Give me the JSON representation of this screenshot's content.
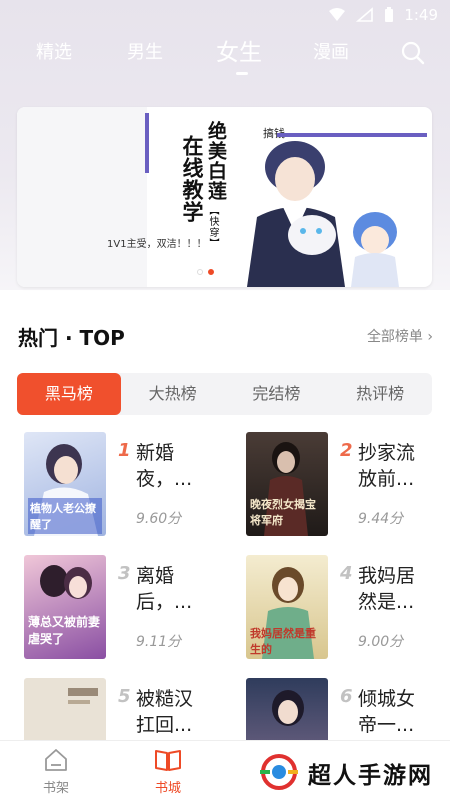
{
  "status_bar": {
    "time": "1:49"
  },
  "top_nav": {
    "tabs": [
      {
        "label": "精选",
        "active": false
      },
      {
        "label": "男生",
        "active": false
      },
      {
        "label": "女生",
        "active": true
      },
      {
        "label": "漫画",
        "active": false
      }
    ]
  },
  "banner": {
    "title_col1": "在线教学",
    "title_col2": "绝美白莲",
    "subtag": "【快穿】",
    "tag": "搞钱",
    "caption": "1V1主受，双洁！！！",
    "active_dot": 1,
    "dot_count": 2
  },
  "section": {
    "title": "热门 · TOP",
    "all_rank": "全部榜单 ›"
  },
  "rank_tabs": [
    {
      "label": "黑马榜",
      "active": true
    },
    {
      "label": "大热榜",
      "active": false
    },
    {
      "label": "完结榜",
      "active": false
    },
    {
      "label": "热评榜",
      "active": false
    }
  ],
  "books": [
    {
      "rank": "1",
      "title": "新婚夜，...",
      "score": "9.60分",
      "cover_text": "植物人老公撩醒了",
      "cover_color": "#b9c8ea"
    },
    {
      "rank": "2",
      "title": "抄家流放前...",
      "score": "9.44分",
      "cover_text": "晚夜烈女揭宝将军府",
      "cover_color": "#3b2f2c"
    },
    {
      "rank": "3",
      "title": "离婚后，...",
      "score": "9.11分",
      "cover_text": "薄总又被前妻虐哭了",
      "cover_color": "#8a4fa3"
    },
    {
      "rank": "4",
      "title": "我妈居然是...",
      "score": "9.00分",
      "cover_text": "我妈居然是重生的",
      "cover_color": "#e8d8a8"
    },
    {
      "rank": "5",
      "title": "被糙汉扛回...",
      "score": "",
      "cover_text": "",
      "cover_color": "#e9e2d6"
    },
    {
      "rank": "6",
      "title": "倾城女帝一...",
      "score": "",
      "cover_text": "",
      "cover_color": "#2f3c5c"
    }
  ],
  "bottom_nav": [
    {
      "label": "书架",
      "active": false
    },
    {
      "label": "书城",
      "active": true
    }
  ],
  "watermark": {
    "text": "超人手游网"
  },
  "colors": {
    "accent": "#ee4a26",
    "tab_bg": "#f3f3f5"
  }
}
